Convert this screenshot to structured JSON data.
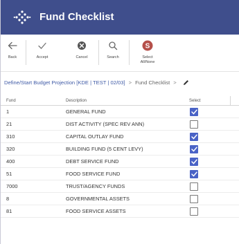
{
  "window": {
    "title": "Fund Checklist"
  },
  "toolbar": {
    "back": "Back",
    "accept": "Accept",
    "cancel": "Cancel",
    "search": "Search",
    "select_all_none_line1": "Select",
    "select_all_none_line2": "All/None"
  },
  "breadcrumb": {
    "link": "Define/Start Budget Projection [KDE | TEST | 02/03]",
    "separator": ">",
    "current": "Fund Checklist",
    "trailing_separator": ">"
  },
  "table": {
    "headers": {
      "fund": "Fund",
      "description": "Description",
      "select": "Select"
    },
    "rows": [
      {
        "fund": "1",
        "description": "GENERAL FUND",
        "selected": true
      },
      {
        "fund": "21",
        "description": "DIST ACTIVITY (SPEC REV ANN)",
        "selected": false
      },
      {
        "fund": "310",
        "description": "CAPITAL OUTLAY FUND",
        "selected": true
      },
      {
        "fund": "320",
        "description": "BUILDING FUND (5 CENT LEVY)",
        "selected": true
      },
      {
        "fund": "400",
        "description": "DEBT SERVICE FUND",
        "selected": true
      },
      {
        "fund": "51",
        "description": "FOOD SERVICE FUND",
        "selected": true
      },
      {
        "fund": "7000",
        "description": "TRUST/AGENCY FUNDS",
        "selected": false
      },
      {
        "fund": "8",
        "description": "GOVERNMENTAL ASSETS",
        "selected": false
      },
      {
        "fund": "81",
        "description": "FOOD SERVICE ASSETS",
        "selected": false
      }
    ]
  },
  "colors": {
    "title_bar": "#3f4e8c",
    "checkbox_checked": "#4a63c6",
    "link": "#3f5aa6",
    "select_all_icon": "#b5504a"
  }
}
